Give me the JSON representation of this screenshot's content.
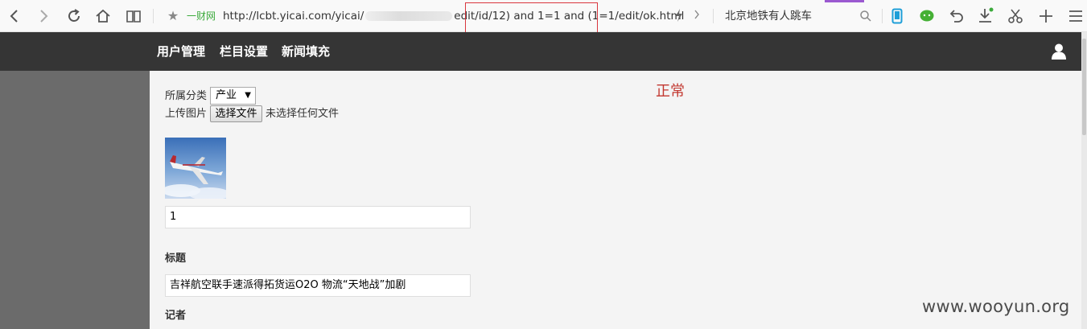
{
  "browser": {
    "site_label": "一财网",
    "url_prefix": "http://lcbt.yicai.com/yicai/",
    "url_suffix": "edit/id/12) and 1=1 and (1=1/edit/ok.html",
    "search_text": "北京地铁有人跳车",
    "colors": {
      "highlight_border": "#d9363e",
      "tab_accent": "#9b59d0"
    }
  },
  "app": {
    "menu": [
      "用户管理",
      "栏目设置",
      "新闻填充"
    ]
  },
  "form": {
    "category_label": "所属分类",
    "category_value": "产业",
    "upload_label": "上传图片",
    "choose_file_button": "选择文件",
    "no_file_text": "未选择任何文件",
    "number_value": "1",
    "title_label": "标题",
    "title_value": "吉祥航空联手速派得拓货运O2O 物流“天地战”加剧",
    "reporter_label": "记者"
  },
  "status_text": "正常",
  "watermark": "www.wooyun.org",
  "colors": {
    "header_bg": "#353535",
    "status_red": "#c2372f",
    "gutter": "#6b6b6b"
  }
}
